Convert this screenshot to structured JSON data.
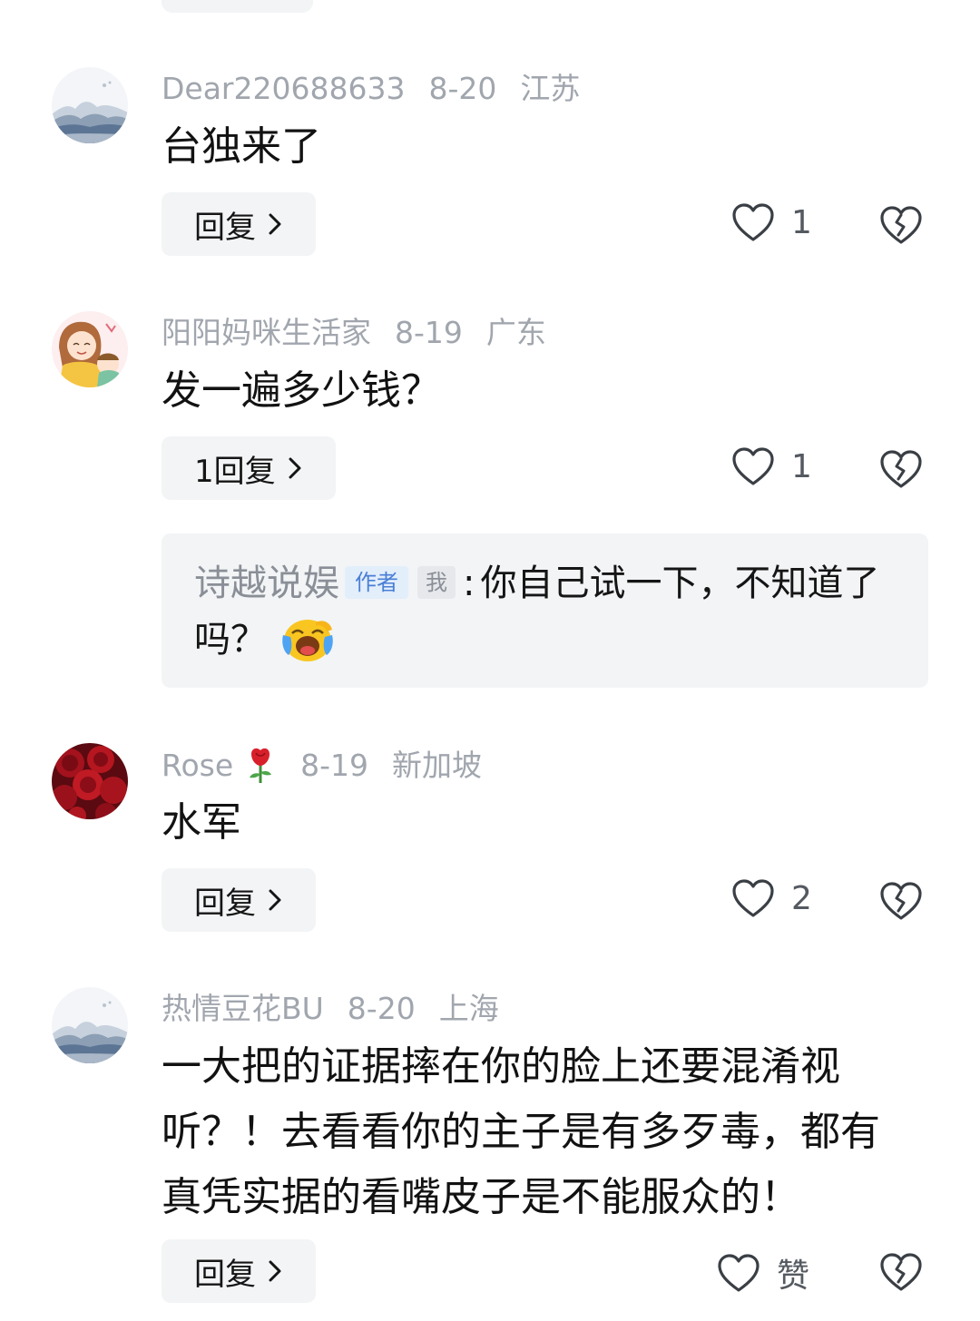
{
  "comments": [
    {
      "username": "Dear220688633",
      "date": "8-20",
      "location": "江苏",
      "text": "台独来了",
      "reply_label": "回复",
      "likes": "1",
      "avatar": "mountain-landscape"
    },
    {
      "username": "阳阳妈咪生活家",
      "date": "8-19",
      "location": "广东",
      "text": "发一遍多少钱？",
      "reply_label": "1回复",
      "likes": "1",
      "avatar": "cartoon-mother-child",
      "sub_reply": {
        "author": "诗越说娱",
        "author_tag": "作者",
        "me_tag": "我",
        "separator": ":",
        "text": "你自己试一下，不知道了吗？",
        "emoji": "laughing-crying-emoji"
      }
    },
    {
      "username": "Rose",
      "date": "8-19",
      "location": "新加坡",
      "text": "水军",
      "reply_label": "回复",
      "likes": "2",
      "avatar": "red-roses",
      "name_emoji": "rose-emoji"
    },
    {
      "username": "热情豆花BU",
      "date": "8-20",
      "location": "上海",
      "text": "一大把的证据摔在你的脸上还要混淆视听？！去看看你的主子是有多歹毒，都有真凭实据的看嘴皮子是不能服众的！",
      "reply_label": "回复",
      "likes": "赞",
      "avatar": "mountain-landscape"
    }
  ],
  "colors": {
    "meta_text": "#a1a6ae",
    "button_bg": "#f2f4f6",
    "author_tag": "#4a7fd6"
  },
  "icons": [
    "heart-outline-icon",
    "broken-heart-icon",
    "chevron-right-icon"
  ]
}
